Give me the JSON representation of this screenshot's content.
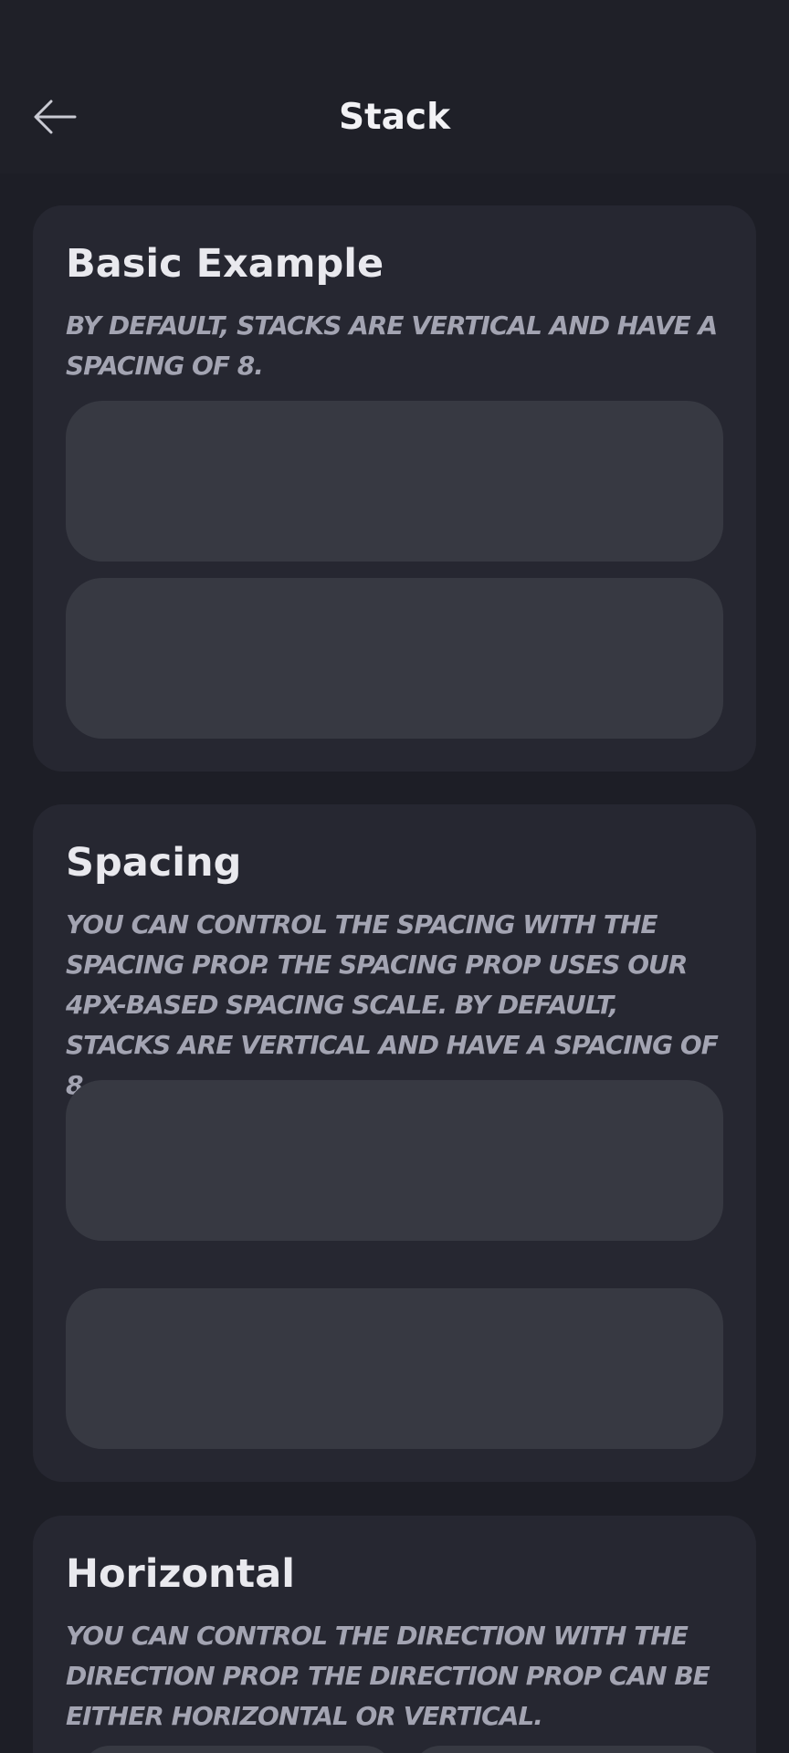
{
  "header": {
    "title": "Stack",
    "back_icon": "arrow-left-icon"
  },
  "sections": [
    {
      "title": "Basic Example",
      "description": "By default, stacks are vertical and have a spacing of 8."
    },
    {
      "title": "Spacing",
      "description": "You can control the spacing with the spacing prop. The spacing prop uses our 4px-based spacing scale. By default, stacks are vertical and have a spacing of 8."
    },
    {
      "title": "Horizontal",
      "description": "You can control the direction with the direction prop. The direction prop can be either horizontal or vertical."
    }
  ],
  "colors": {
    "background": "#1d1e26",
    "header": "#1f2028",
    "card": "#262731",
    "box": "#373942",
    "title_text": "#e9e9ee",
    "description_text": "#a3a4b2"
  }
}
